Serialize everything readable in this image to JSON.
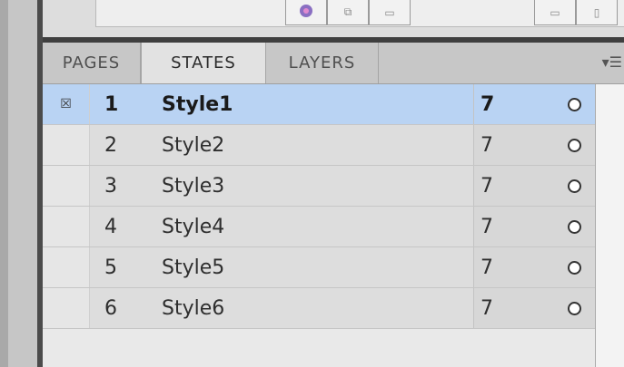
{
  "tabs": [
    {
      "label": "PAGES",
      "active": false
    },
    {
      "label": "STATES",
      "active": true
    },
    {
      "label": "LAYERS",
      "active": false
    }
  ],
  "panel_menu_icon": "panel-menu-icon",
  "rows": [
    {
      "index": "1",
      "name": "Style1",
      "count": "7",
      "selected": true,
      "check_icon": "☒"
    },
    {
      "index": "2",
      "name": "Style2",
      "count": "7",
      "selected": false,
      "check_icon": ""
    },
    {
      "index": "3",
      "name": "Style3",
      "count": "7",
      "selected": false,
      "check_icon": ""
    },
    {
      "index": "4",
      "name": "Style4",
      "count": "7",
      "selected": false,
      "check_icon": ""
    },
    {
      "index": "5",
      "name": "Style5",
      "count": "7",
      "selected": false,
      "check_icon": ""
    },
    {
      "index": "6",
      "name": "Style6",
      "count": "7",
      "selected": false,
      "check_icon": ""
    }
  ],
  "colors": {
    "selected_row": "#b9d3f3",
    "panel_bg": "#e9e9e9"
  }
}
